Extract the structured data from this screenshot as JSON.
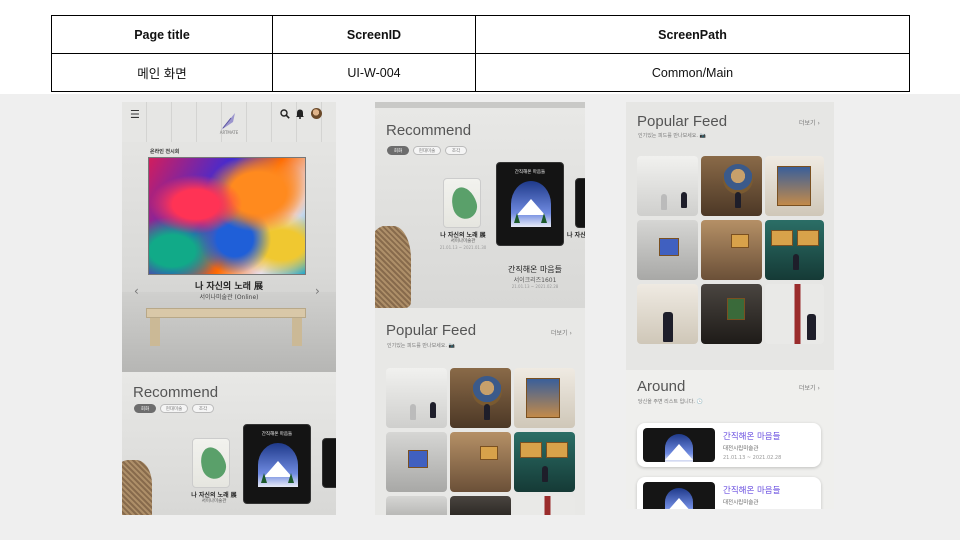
{
  "spec_table": {
    "headers": [
      "Page title",
      "ScreenID",
      "ScreenPath"
    ],
    "values": [
      "메인 화면",
      "UI-W-004",
      "Common/Main"
    ]
  },
  "phone1": {
    "logo_text": "ARTMATE",
    "exhibit_label": "온라인 전시회",
    "exhibit_title": "나 자신의 노래 展",
    "exhibit_venue": "서이나미술관 (Online)",
    "recommend_title": "Recommend",
    "chips": [
      "회화",
      "현대미술",
      "조각"
    ],
    "poster1": {
      "name": "나 자신의 노래 展",
      "venue": "서이나미술관"
    },
    "poster2": {
      "title": "간직해온 마음들"
    }
  },
  "phone2": {
    "recommend_title": "Recommend",
    "chips": [
      "회화",
      "현대미술",
      "조각"
    ],
    "poster1": {
      "name": "나 자신의 노래 展",
      "venue": "서이나미술관",
      "date": "21.01.13 ~ 2021.01.30"
    },
    "poster2": {
      "title": "간직해온 마음들",
      "name": "간직해온 마음들",
      "venue": "서이크리즈1601",
      "date": "21.01.13 ~ 2021.02.28"
    },
    "poster3_partial": "나 자신",
    "feed_title": "Popular Feed",
    "feed_sub": "인기있는 피드를 만나보세요. 📷",
    "more": "더보기 ›"
  },
  "phone3": {
    "feed_title": "Popular Feed",
    "feed_sub": "인기있는 피드를 만나보세요. 📷",
    "more": "더보기 ›",
    "around_title": "Around",
    "around_sub": "당신을 주변 리스트 입니다. 🕓",
    "around_more": "더보기 ›",
    "cards": [
      {
        "name": "간직해온 마음들",
        "venue": "대전시립미술관",
        "date": "21.01.13 ~ 2021.02.28"
      },
      {
        "name": "간직해온 마음들",
        "venue": "대전시립미술관",
        "date": ""
      }
    ]
  },
  "icons": {
    "menu": "☰",
    "search": "🔍",
    "bell": "🔔",
    "prev": "‹",
    "next": "›",
    "pin": "📍",
    "tag": "🏷"
  }
}
